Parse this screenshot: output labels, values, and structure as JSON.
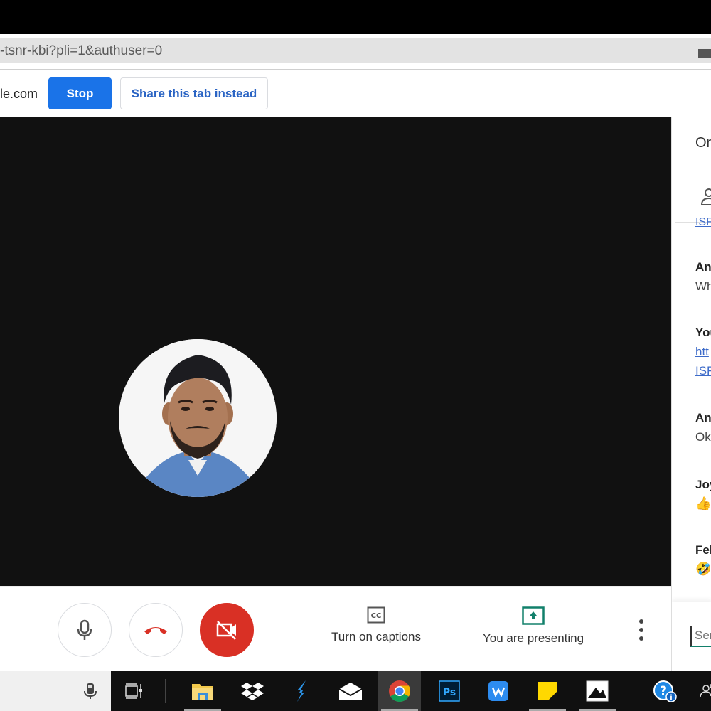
{
  "browser": {
    "address_text": "-tsnr-kbi?pli=1&authuser=0",
    "camera_indicator": "camera-in-use-icon"
  },
  "share_bar": {
    "domain_text": "le.com",
    "stop_label": "Stop",
    "share_tab_label": "Share this tab instead"
  },
  "video": {
    "participant_avatar": "avatar-photo",
    "background_color": "#111111"
  },
  "side_panel": {
    "title_partial": "Or",
    "partial_link": "ISF",
    "messages": [
      {
        "sender": "An",
        "text": "Wh"
      },
      {
        "sender": "You",
        "links": [
          "htt",
          "ISF"
        ]
      },
      {
        "sender": "An",
        "text": "Ok"
      },
      {
        "sender": "Joy",
        "emoji": "👍"
      },
      {
        "sender": "Fel",
        "emoji": "🤣"
      }
    ],
    "send_placeholder": "Sen"
  },
  "controls": {
    "mic_icon": "microphone-icon",
    "hangup_icon": "phone-hangup-icon",
    "camera_off_icon": "camera-off-icon",
    "captions_label": "Turn on captions",
    "presenting_label": "You are presenting",
    "accent_red": "#d93025",
    "accent_green": "#12806b",
    "accent_blue": "#1a73e8"
  },
  "taskbar": {
    "items": [
      {
        "name": "task-view",
        "active": false
      },
      {
        "name": "file-explorer",
        "active": false
      },
      {
        "name": "dropbox",
        "active": false
      },
      {
        "name": "app-s",
        "active": false
      },
      {
        "name": "mail",
        "active": false
      },
      {
        "name": "chrome",
        "active": true
      },
      {
        "name": "photoshop",
        "label": "Ps",
        "active": false
      },
      {
        "name": "wps-office",
        "label": "W",
        "active": false
      },
      {
        "name": "sticky-notes",
        "active": false
      },
      {
        "name": "photos",
        "active": false
      },
      {
        "name": "help",
        "active": false
      },
      {
        "name": "people",
        "active": false
      }
    ]
  }
}
